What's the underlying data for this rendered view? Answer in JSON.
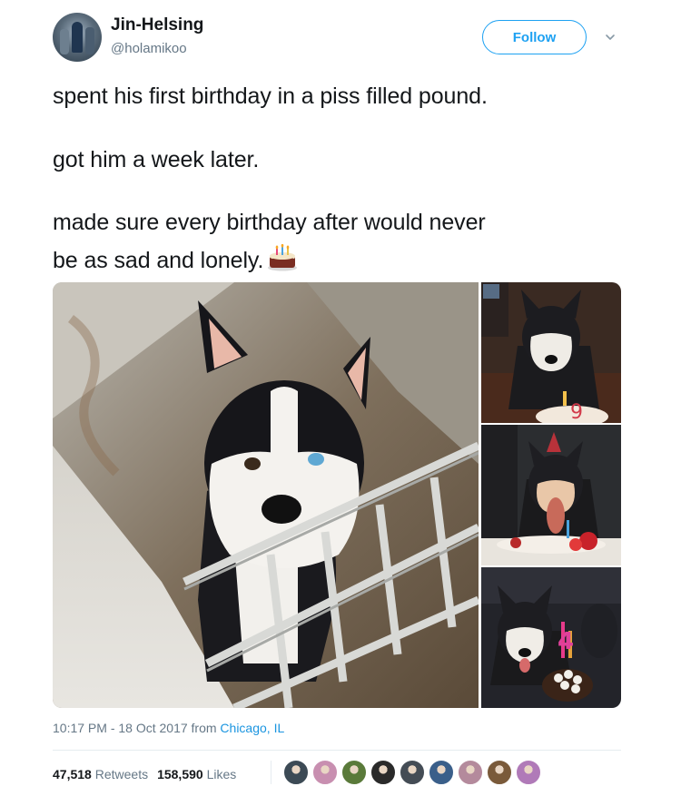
{
  "author": {
    "name": "Jin-Helsing",
    "handle": "@holamikoo",
    "avatar_icon": "profile-avatar"
  },
  "follow_label": "Follow",
  "tweet_text": {
    "line1": "spent his first birthday in a piss filled pound.",
    "line2": "got him a week later.",
    "line3": "made sure every birthday after would never",
    "line4": "be as sad and lonely.",
    "emoji": "birthday-cake-icon"
  },
  "media": {
    "photo_count": 4,
    "icons": [
      "husky-in-pound",
      "husky-birthday-1",
      "husky-birthday-2",
      "husky-birthday-3"
    ]
  },
  "meta": {
    "time_date": "10:17 PM - 18 Oct 2017 from ",
    "place": "Chicago, IL"
  },
  "stats": {
    "retweets_count": "47,518",
    "retweets_label": "Retweets",
    "likes_count": "158,590",
    "likes_label": "Likes"
  },
  "likers": {
    "count": 9,
    "colors": [
      "#3c4a55",
      "#c88fb0",
      "#5a7a3a",
      "#2a2a2a",
      "#444c55",
      "#3a5f8a",
      "#b48a9c",
      "#7a5a3a",
      "#b07ab8"
    ]
  },
  "colors": {
    "accent": "#1da1f2",
    "link": "#1b95e0",
    "muted": "#657786",
    "text": "#14171a"
  }
}
